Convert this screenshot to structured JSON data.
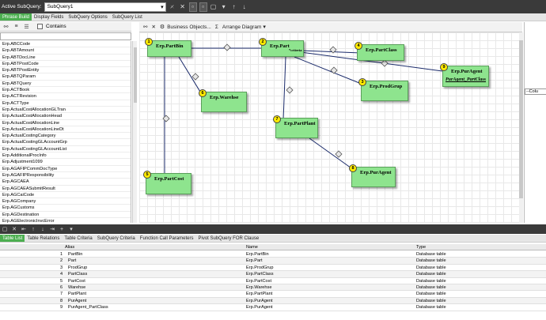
{
  "header": {
    "active_label": "Active SubQuery:",
    "selected": "SubQuery1"
  },
  "main_tabs": [
    "Phrase Build",
    "Display Fields",
    "SubQuery Options",
    "SubQuery List"
  ],
  "left": {
    "contains_label": "Contains",
    "fields": [
      "Erp.ABCCode",
      "Erp.ABTAmount",
      "Erp.ABTDocLine",
      "Erp.ABTPostCode",
      "Erp.ABTPostEntity",
      "Erp.ABTQParam",
      "Erp.ABTQuery",
      "Erp.ACTBook",
      "Erp.ACTRevision",
      "Erp.ACTType",
      "Erp.ActualCostAllocationGLTran",
      "Erp.ActualCostAllocationHead",
      "Erp.ActualCostAllocationLine",
      "Erp.ActualCostAllocationLineDt",
      "Erp.ActualCostingCategory",
      "Erp.ActualCostingGLAccountGrp",
      "Erp.ActualCostingGLAccountList",
      "Erp.AdditionalProcInfo",
      "Erp.Adjustment1099",
      "Erp.AGAFIPCommDocType",
      "Erp.AGAFIPResponsibility",
      "Erp.AGCAEA",
      "Erp.AGCAEASubmitResult",
      "Erp.AGCaiCode",
      "Erp.AGCompany",
      "Erp.AGCustoms",
      "Erp.AGDestination",
      "Erp.AGElectronicInvcError"
    ]
  },
  "canvas_toolbar": {
    "business_objects": "Business Objects...",
    "sigma": "Σ",
    "arrange": "Arrange Diagram"
  },
  "tables": [
    {
      "num": "1",
      "name": "Erp.PartBin"
    },
    {
      "num": "2",
      "name": "Erp.Part",
      "sub": "*criteria"
    },
    {
      "num": "4",
      "name": "Erp.PartClass"
    },
    {
      "num": "9",
      "name": "Erp.PurAgent",
      "underline": "PurAgent_PartClass"
    },
    {
      "num": "3",
      "name": "Erp.ProdGrup"
    },
    {
      "num": "6",
      "name": "Erp.Warehse"
    },
    {
      "num": "7",
      "name": "Erp.PartPlant"
    },
    {
      "num": "8",
      "name": "Erp.PurAgent"
    },
    {
      "num": "5",
      "name": "Erp.PartCost"
    }
  ],
  "right_pane": {
    "label": "--Colu"
  },
  "bottom_tabs": [
    "Table List",
    "Table Relations",
    "Table Criteria",
    "SubQuery Criteria",
    "Function Call Parameters",
    "Pivot SubQuery FOR Clause"
  ],
  "grid": {
    "headers": [
      "Alias",
      "Name",
      "Type"
    ],
    "rows": [
      {
        "n": "1",
        "alias": "PartBin",
        "name": "Erp.PartBin",
        "type": "Database table"
      },
      {
        "n": "2",
        "alias": "Part",
        "name": "Erp.Part",
        "type": "Database table"
      },
      {
        "n": "3",
        "alias": "ProdGrup",
        "name": "Erp.ProdGrup",
        "type": "Database table"
      },
      {
        "n": "4",
        "alias": "PartClass",
        "name": "Erp.PartClass",
        "type": "Database table"
      },
      {
        "n": "5",
        "alias": "PartCost",
        "name": "Erp.PartCost",
        "type": "Database table"
      },
      {
        "n": "6",
        "alias": "Warehse",
        "name": "Erp.Warehse",
        "type": "Database table"
      },
      {
        "n": "7",
        "alias": "PartPlant",
        "name": "Erp.PartPlant",
        "type": "Database table"
      },
      {
        "n": "8",
        "alias": "PurAgent",
        "name": "Erp.PurAgent",
        "type": "Database table"
      },
      {
        "n": "9",
        "alias": "PurAgent_PartClass",
        "name": "Erp.PurAgent",
        "type": "Database table"
      }
    ]
  }
}
